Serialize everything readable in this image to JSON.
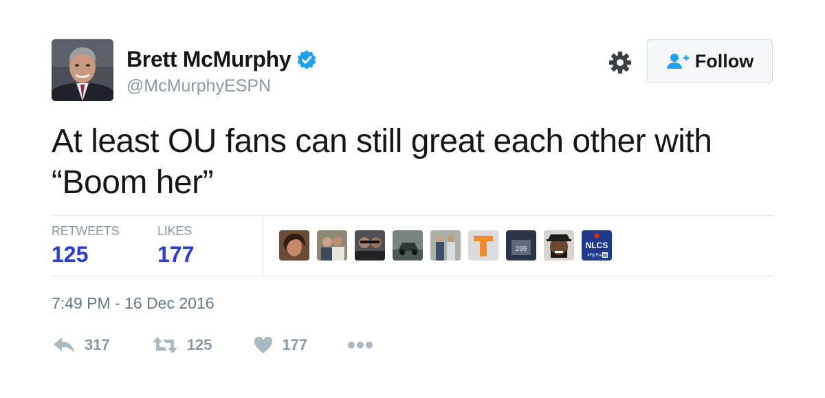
{
  "author": {
    "display_name": "Brett McMurphy",
    "handle": "@McMurphyESPN",
    "verified": true,
    "verified_color": "#1da1f2"
  },
  "follow_button": {
    "label": "Follow",
    "icon": "add-user-icon",
    "icon_color": "#1da1f2"
  },
  "settings_icon": "gear-icon",
  "tweet": {
    "text_line1": "At least OU fans can still great each other with",
    "text_line2": "“Boom her”"
  },
  "stats": {
    "retweets_label": "RETWEETS",
    "retweets_value": "125",
    "likes_label": "LIKES",
    "likes_value": "177",
    "value_color": "#2b3bd6"
  },
  "likers": [
    {
      "name": "liker-avatar-1"
    },
    {
      "name": "liker-avatar-2"
    },
    {
      "name": "liker-avatar-3"
    },
    {
      "name": "liker-avatar-4"
    },
    {
      "name": "liker-avatar-5"
    },
    {
      "name": "liker-avatar-6"
    },
    {
      "name": "liker-avatar-7",
      "badge": "299"
    },
    {
      "name": "liker-avatar-8"
    },
    {
      "name": "liker-avatar-9",
      "badge": "NLCS",
      "sub": "#FlyThe W"
    }
  ],
  "timestamp": "7:49 PM - 16 Dec 2016",
  "actions": {
    "reply_count": "317",
    "retweet_count": "125",
    "like_count": "177",
    "icon_color": "#aab8c2"
  }
}
